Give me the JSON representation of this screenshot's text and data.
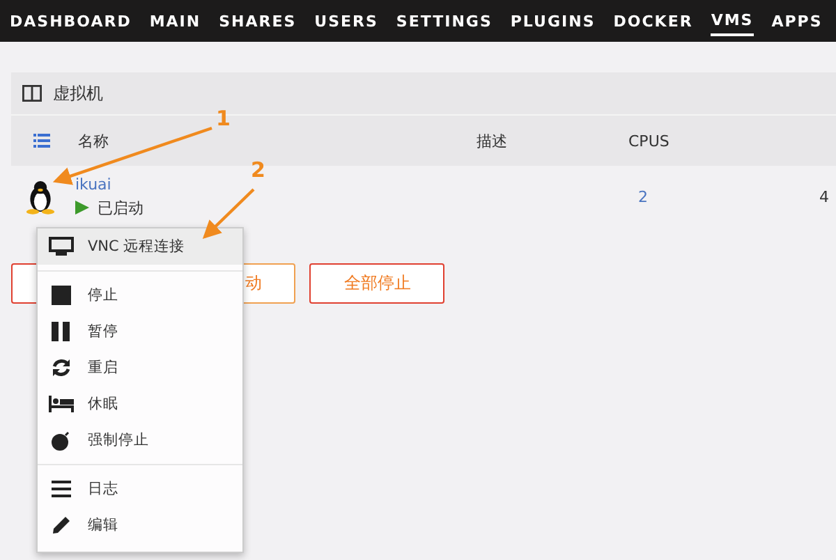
{
  "nav": [
    {
      "label": "DASHBOARD",
      "selected": false
    },
    {
      "label": "MAIN",
      "selected": false
    },
    {
      "label": "SHARES",
      "selected": false
    },
    {
      "label": "USERS",
      "selected": false
    },
    {
      "label": "SETTINGS",
      "selected": false
    },
    {
      "label": "PLUGINS",
      "selected": false
    },
    {
      "label": "DOCKER",
      "selected": false
    },
    {
      "label": "VMS",
      "selected": true
    },
    {
      "label": "APPS",
      "selected": false
    }
  ],
  "panel": {
    "title": "虚拟机",
    "columns": [
      "名称",
      "描述",
      "CPUS"
    ],
    "rows": [
      {
        "name": "ikuai",
        "status": "已启动",
        "running": true,
        "cpus": "2",
        "column_4": "4"
      }
    ]
  },
  "buttons": [
    {
      "kind": "danger"
    },
    {
      "label": "动",
      "kind": "normal"
    },
    {
      "label": "全部停止",
      "kind": "danger"
    }
  ],
  "menu": {
    "groups": [
      [
        {
          "label": "VNC 远程连接",
          "kind": "monitor",
          "selected": true
        }
      ],
      [
        {
          "label": "停止",
          "kind": "stop",
          "selected": false
        },
        {
          "label": "暂停",
          "kind": "pause",
          "selected": false
        },
        {
          "label": "重启",
          "kind": "refresh",
          "selected": false
        },
        {
          "label": "休眠",
          "kind": "bed",
          "selected": false
        },
        {
          "label": "强制停止",
          "kind": "bomb",
          "selected": false
        }
      ],
      [
        {
          "label": "日志",
          "kind": "list",
          "selected": false
        },
        {
          "label": "编辑",
          "kind": "pencil",
          "selected": false
        }
      ]
    ]
  },
  "annotations": [
    "1",
    "2"
  ]
}
